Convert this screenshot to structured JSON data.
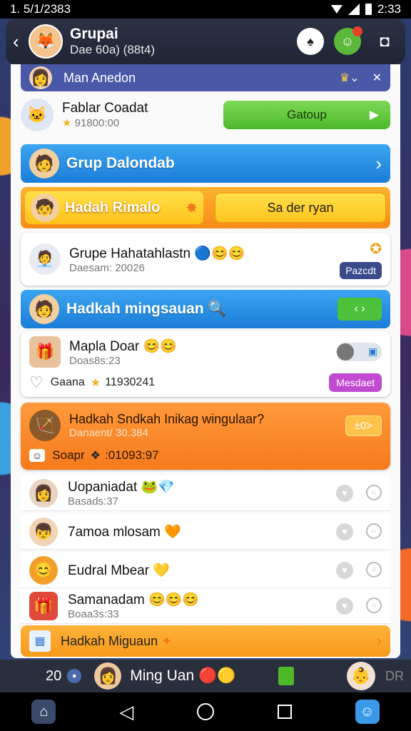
{
  "status_bar": {
    "time_left": "1. 5/1/2383",
    "time_right": "2:33"
  },
  "header": {
    "title": "Grupai",
    "subtitle": "Dae 60a) (88t4)"
  },
  "rows": {
    "r1": {
      "label": "Man Anedon"
    },
    "r2": {
      "name": "Fablar Coadat",
      "meta": "91800:00",
      "button": "Gatoup"
    },
    "r3": {
      "label": "Grup Dalondab"
    },
    "r4": {
      "label": "Hadah Rimalo",
      "button": "Sa der ryan"
    },
    "r5": {
      "name": "Grupe Hahatahlastn",
      "meta": "Daesam: 20026",
      "badge": "Pazcdt"
    },
    "r6": {
      "label": "Hadkah mingsauan",
      "button": "‹ ›"
    },
    "r7": {
      "name": "Mapla Doar",
      "meta": "Doas8s:23",
      "sub_label": "Gaana",
      "sub_meta": "11930241",
      "button": "Mesdaet"
    },
    "r8": {
      "name": "Hadkah Sndkah Inikag wingulaar?",
      "meta": "Danaent/ 30.384",
      "sub_label": "Soapr",
      "sub_meta": ":01093:97",
      "button": "±0>"
    }
  },
  "list": [
    {
      "name": "Uopaniadat",
      "meta": "Basads:37"
    },
    {
      "name": "7amoa mlosam",
      "meta": ""
    },
    {
      "name": "Eudral Mbear",
      "meta": ""
    },
    {
      "name": "Samanadam",
      "meta": "Boaa3s:33"
    }
  ],
  "bottom_row": {
    "label": "Hadkah Miguaun"
  },
  "chat_bar": {
    "count": "20",
    "name": "Ming Uan",
    "right_label": "DR"
  },
  "colors": {
    "blue_row": "#1b7dd8",
    "orange_row": "#f57a1c",
    "green_btn": "#4cb82a",
    "purple_btn": "#c24ad0",
    "navy_badge": "#3a4a8a"
  }
}
